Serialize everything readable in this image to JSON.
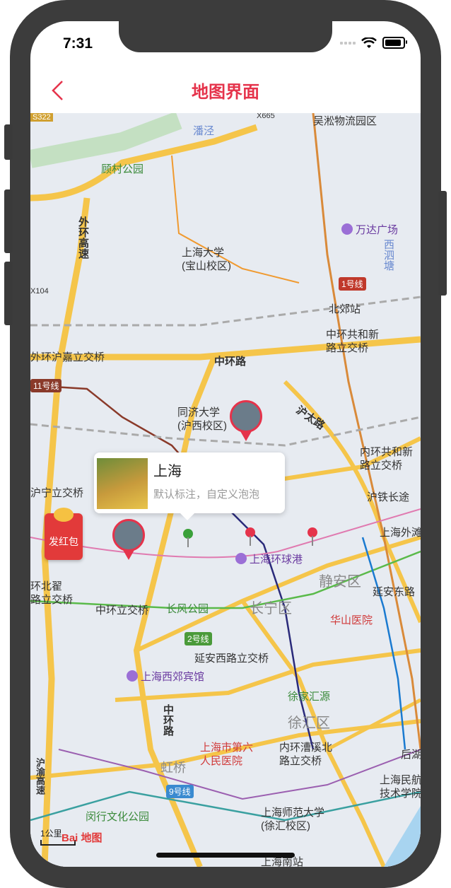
{
  "status": {
    "time": "7:31"
  },
  "nav": {
    "back_icon": "chevron-left-icon",
    "title": "地图界面"
  },
  "map": {
    "labels": {
      "gucun": "顾村公园",
      "wusong": "吴淞物流园区",
      "wanda": "万达广场",
      "xisitang": "西泗塘",
      "shu": "上海大学\n(宝山校区)",
      "line1": "1号线",
      "beijiao": "北郊站",
      "zhonghuan_gongxin": "中环共和新\n路立交桥",
      "waihuan_hujia": "外环沪嘉立交桥",
      "huanlu": "中环路",
      "line11": "11号线",
      "tongji": "同济大学\n(沪西校区)",
      "hutai": "沪太路",
      "neihuan_gongxin": "内环共和新\n路立交桥",
      "hutie": "沪铁长途",
      "huning": "沪宁立交桥",
      "shanghai_waitan": "上海外滩",
      "huanqiu": "上海环球港",
      "jingan": "静安区",
      "yanan_east": "延安东路",
      "zhonghuan_lijiao": "中环立交桥",
      "changfeng": "长风公园",
      "changning": "长宁区",
      "huashan": "华山医院",
      "line2": "2号线",
      "yanan_west": "延安西路立交桥",
      "xijiao": "上海西郊宾馆",
      "xujiahui": "徐家汇源",
      "xuhui": "徐汇区",
      "hospital6": "上海市第六\n人民医院",
      "caoxi": "内环漕溪北\n路立交桥",
      "hongqiao": "虹桥",
      "line9": "9号线",
      "minhang": "闵行文化公园",
      "shnu": "上海师范大学\n(徐汇校区)",
      "minhang_tech": "上海民航\n技术学院",
      "shanghai_nan": "上海南站",
      "waihuan_gao": "外环高速",
      "zhonghuan_road": "中环路",
      "caoxi_w": "环北翟\n路立交桥",
      "panjing": "潘泾",
      "x665": "X665",
      "s322": "S322",
      "x104": "X104",
      "huxi": "后湖",
      "shanghai_west_road": "沪渝高速"
    },
    "scale_label": "1公里",
    "logo_text": "Bai 地图"
  },
  "bubble": {
    "title": "上海",
    "subtitle": "默认标注，自定义泡泡"
  },
  "red_packet": {
    "label": "发红包"
  },
  "colors": {
    "accent": "#e5334b",
    "map_bg": "#e7ebf1",
    "road_major": "#f5c54a"
  }
}
